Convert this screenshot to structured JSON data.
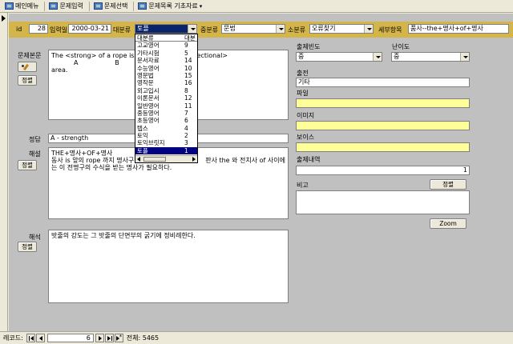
{
  "menubar": {
    "items": [
      {
        "label": "메인메뉴"
      },
      {
        "label": "문제입력"
      },
      {
        "label": "문제선택"
      },
      {
        "label": "문제목록 기초자료"
      }
    ]
  },
  "header": {
    "id_label": "id",
    "id_value": "28",
    "date_label": "입력일",
    "date_value": "2000-03-21",
    "major_label": "대분류",
    "major_value": "토플",
    "middle_label": "중분류",
    "middle_value": "문법",
    "minor_label": "소분류",
    "minor_value": "오류찾기",
    "detail_label": "세부항목",
    "detail_value": "품사--the+명사+of+명사"
  },
  "dropdown": {
    "header": {
      "name": "대분류",
      "code": "대분"
    },
    "items": [
      {
        "name": "고교영어",
        "code": "9"
      },
      {
        "name": "기타시험",
        "code": "5"
      },
      {
        "name": "문서자료",
        "code": "14"
      },
      {
        "name": "수능영어",
        "code": "10"
      },
      {
        "name": "영문법",
        "code": "15"
      },
      {
        "name": "영작문",
        "code": "16"
      },
      {
        "name": "외고입시",
        "code": "8"
      },
      {
        "name": "이론문서",
        "code": "12"
      },
      {
        "name": "일반영어",
        "code": "11"
      },
      {
        "name": "중등영어",
        "code": "7"
      },
      {
        "name": "초등영어",
        "code": "6"
      },
      {
        "name": "텝스",
        "code": "4"
      },
      {
        "name": "토익",
        "code": "2"
      },
      {
        "name": "토익브릿지",
        "code": "3"
      },
      {
        "name": "토플",
        "code": "1"
      }
    ]
  },
  "question": {
    "label": "문제본문",
    "line1_start": "The <strong> of a rope is <dir",
    "line1_end": "to its <cross-sectional>",
    "line2": "           A                  B         C",
    "line3": "area.",
    "sort_button": "정렬"
  },
  "answer": {
    "label": "정답",
    "value": "A - strength"
  },
  "explanation": {
    "label": "해설",
    "line1": "THE+명사+OF+명사",
    "line2_start": "동사 is 앞의 rope 까지 명사구 주",
    "line2_end": "판사 the 와 전치사 of 사이에",
    "line3": "는 이 전명구의 수식을 받는 명사가 필요하다.",
    "sort_button": "정렬"
  },
  "translation": {
    "label": "해석",
    "value": "밧줄의 강도는 그 밧줄의 단면부의 굵기에 정비례한다.",
    "sort_button": "정렬"
  },
  "right_panel": {
    "frequency_label": "출제빈도",
    "frequency_value": "중",
    "difficulty_label": "난이도",
    "difficulty_value": "중",
    "source_label": "출전",
    "source_value": "기타",
    "file_label": "파일",
    "file_value": "",
    "image_label": "이미지",
    "image_value": "",
    "voice_label": "보이스",
    "voice_value": "",
    "history_label": "출제내역",
    "history_value": "1",
    "note_label": "비고",
    "note_sort_button": "정렬",
    "note_value": "",
    "zoom_button": "Zoom"
  },
  "statusbar": {
    "record_label": "레코드:",
    "current_record": "6",
    "total_label": "전체: 5465"
  }
}
